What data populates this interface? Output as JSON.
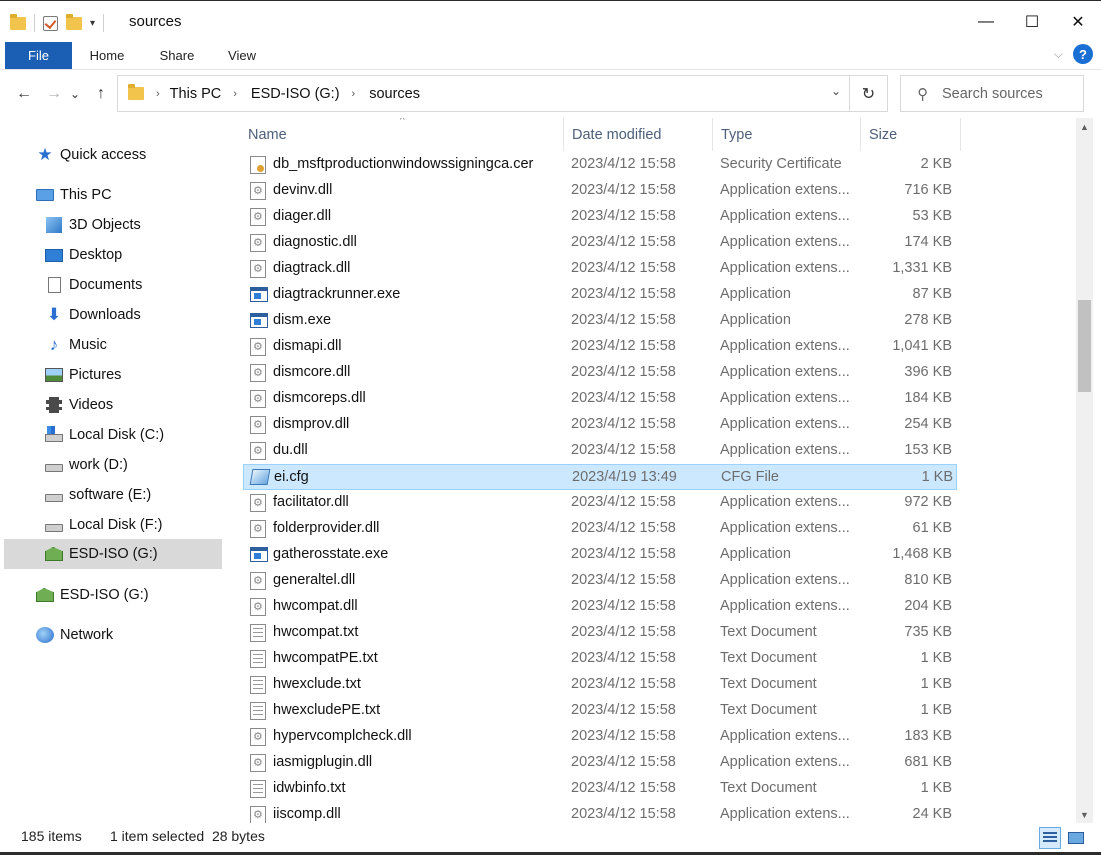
{
  "window": {
    "title": "sources",
    "qat_dropdown": "▾",
    "minimize_glyph": "—",
    "maximize_glyph": "☐",
    "close_glyph": "✕"
  },
  "ribbon": {
    "tabs": [
      {
        "label": "File"
      },
      {
        "label": "Home"
      },
      {
        "label": "Share"
      },
      {
        "label": "View"
      }
    ],
    "help_glyph": "?",
    "collapse_glyph": "⌵"
  },
  "address": {
    "back_glyph": "←",
    "forward_glyph": "→",
    "recent_glyph": "⌄",
    "up_glyph": "↑",
    "crumb_sep": "›",
    "crumbs": [
      "This PC",
      "ESD-ISO (G:)",
      "sources"
    ],
    "dropdown_glyph": "⌄",
    "refresh_glyph": "↻"
  },
  "search": {
    "placeholder": "Search sources",
    "icon_glyph": "⚲"
  },
  "nav": {
    "items": [
      {
        "label": "Quick access",
        "icon": "star-icon"
      },
      {
        "label": "This PC",
        "icon": "computer-icon"
      },
      {
        "label": "3D Objects",
        "icon": "3d-objects-icon"
      },
      {
        "label": "Desktop",
        "icon": "desktop-icon"
      },
      {
        "label": "Documents",
        "icon": "documents-icon"
      },
      {
        "label": "Downloads",
        "icon": "downloads-icon"
      },
      {
        "label": "Music",
        "icon": "music-icon"
      },
      {
        "label": "Pictures",
        "icon": "pictures-icon"
      },
      {
        "label": "Videos",
        "icon": "videos-icon"
      },
      {
        "label": "Local Disk (C:)",
        "icon": "windows-drive-icon"
      },
      {
        "label": "work (D:)",
        "icon": "drive-icon"
      },
      {
        "label": "software (E:)",
        "icon": "drive-icon"
      },
      {
        "label": "Local Disk (F:)",
        "icon": "drive-icon"
      },
      {
        "label": "ESD-ISO (G:)",
        "icon": "dvd-drive-icon",
        "selected": true
      },
      {
        "label": "ESD-ISO (G:)",
        "icon": "dvd-drive-icon"
      },
      {
        "label": "Network",
        "icon": "network-icon"
      }
    ]
  },
  "columns": {
    "name": "Name",
    "date": "Date modified",
    "type": "Type",
    "size": "Size",
    "sort_glyph": "^"
  },
  "files": [
    {
      "name": "db_msftproductionwindowssigningca.cer",
      "date": "2023/4/12 15:58",
      "type": "Security Certificate",
      "size": "2 KB",
      "kind": "cer"
    },
    {
      "name": "devinv.dll",
      "date": "2023/4/12 15:58",
      "type": "Application extens...",
      "size": "716 KB",
      "kind": "dll"
    },
    {
      "name": "diager.dll",
      "date": "2023/4/12 15:58",
      "type": "Application extens...",
      "size": "53 KB",
      "kind": "dll"
    },
    {
      "name": "diagnostic.dll",
      "date": "2023/4/12 15:58",
      "type": "Application extens...",
      "size": "174 KB",
      "kind": "dll"
    },
    {
      "name": "diagtrack.dll",
      "date": "2023/4/12 15:58",
      "type": "Application extens...",
      "size": "1,331 KB",
      "kind": "dll"
    },
    {
      "name": "diagtrackrunner.exe",
      "date": "2023/4/12 15:58",
      "type": "Application",
      "size": "87 KB",
      "kind": "exe"
    },
    {
      "name": "dism.exe",
      "date": "2023/4/12 15:58",
      "type": "Application",
      "size": "278 KB",
      "kind": "exe"
    },
    {
      "name": "dismapi.dll",
      "date": "2023/4/12 15:58",
      "type": "Application extens...",
      "size": "1,041 KB",
      "kind": "dll"
    },
    {
      "name": "dismcore.dll",
      "date": "2023/4/12 15:58",
      "type": "Application extens...",
      "size": "396 KB",
      "kind": "dll"
    },
    {
      "name": "dismcoreps.dll",
      "date": "2023/4/12 15:58",
      "type": "Application extens...",
      "size": "184 KB",
      "kind": "dll"
    },
    {
      "name": "dismprov.dll",
      "date": "2023/4/12 15:58",
      "type": "Application extens...",
      "size": "254 KB",
      "kind": "dll"
    },
    {
      "name": "du.dll",
      "date": "2023/4/12 15:58",
      "type": "Application extens...",
      "size": "153 KB",
      "kind": "dll"
    },
    {
      "name": "ei.cfg",
      "date": "2023/4/19 13:49",
      "type": "CFG File",
      "size": "1 KB",
      "kind": "cfg",
      "selected": true
    },
    {
      "name": "facilitator.dll",
      "date": "2023/4/12 15:58",
      "type": "Application extens...",
      "size": "972 KB",
      "kind": "dll"
    },
    {
      "name": "folderprovider.dll",
      "date": "2023/4/12 15:58",
      "type": "Application extens...",
      "size": "61 KB",
      "kind": "dll"
    },
    {
      "name": "gatherosstate.exe",
      "date": "2023/4/12 15:58",
      "type": "Application",
      "size": "1,468 KB",
      "kind": "exe"
    },
    {
      "name": "generaltel.dll",
      "date": "2023/4/12 15:58",
      "type": "Application extens...",
      "size": "810 KB",
      "kind": "dll"
    },
    {
      "name": "hwcompat.dll",
      "date": "2023/4/12 15:58",
      "type": "Application extens...",
      "size": "204 KB",
      "kind": "dll"
    },
    {
      "name": "hwcompat.txt",
      "date": "2023/4/12 15:58",
      "type": "Text Document",
      "size": "735 KB",
      "kind": "txt"
    },
    {
      "name": "hwcompatPE.txt",
      "date": "2023/4/12 15:58",
      "type": "Text Document",
      "size": "1 KB",
      "kind": "txt"
    },
    {
      "name": "hwexclude.txt",
      "date": "2023/4/12 15:58",
      "type": "Text Document",
      "size": "1 KB",
      "kind": "txt"
    },
    {
      "name": "hwexcludePE.txt",
      "date": "2023/4/12 15:58",
      "type": "Text Document",
      "size": "1 KB",
      "kind": "txt"
    },
    {
      "name": "hypervcomplcheck.dll",
      "date": "2023/4/12 15:58",
      "type": "Application extens...",
      "size": "183 KB",
      "kind": "dll"
    },
    {
      "name": "iasmigplugin.dll",
      "date": "2023/4/12 15:58",
      "type": "Application extens...",
      "size": "681 KB",
      "kind": "dll"
    },
    {
      "name": "idwbinfo.txt",
      "date": "2023/4/12 15:58",
      "type": "Text Document",
      "size": "1 KB",
      "kind": "txt"
    },
    {
      "name": "iiscomp.dll",
      "date": "2023/4/12 15:58",
      "type": "Application extens...",
      "size": "24 KB",
      "kind": "dll"
    }
  ],
  "scrollbar": {
    "up_glyph": "▲",
    "down_glyph": "▼"
  },
  "status": {
    "item_count": "185 items",
    "selection": "1 item selected  28 bytes"
  }
}
